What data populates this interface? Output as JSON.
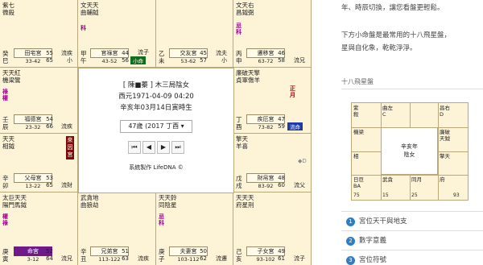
{
  "chart": {
    "cells": [
      {
        "id": "si",
        "stars": "紫七\n微殺",
        "stem": "癸\n巳",
        "palace": "田宅宮",
        "range": "33-42",
        "age": "55\n65",
        "flow": "流疾\n小"
      },
      {
        "id": "wu",
        "stars": "",
        "stem": "甲\n午",
        "palace": "官祿宮",
        "range": "43-52",
        "age": "44\n56",
        "flow": "流子",
        "badge": "小命"
      },
      {
        "id": "wei",
        "stars": "",
        "stem": "乙\n未",
        "palace": "交友宮",
        "range": "53-62",
        "age": "45\n57",
        "flow": "流夫\n小"
      },
      {
        "id": "shen",
        "stars": "文天右\n昌鉞弼",
        "stem": "丙\n申",
        "palace": "遷移宮",
        "range": "63-72",
        "age": "46\n58",
        "flow": "流兄",
        "minor": "忌\n科",
        "mark": "丙"
      },
      {
        "id": "chen",
        "stars": "天天紅\n機梁鸞",
        "stem": "壬\n辰",
        "palace": "福德宮",
        "range": "23-32",
        "age": "54\n66",
        "flow": "流疾",
        "minor": "祿\n權"
      },
      {
        "id": "you",
        "stars": "廉破天擎\n貞軍傷羊",
        "stem": "丁\n酉",
        "palace": "疾厄宮",
        "range": "73-82",
        "age": "47\n59",
        "flow": "流命",
        "minor": "正\n月"
      },
      {
        "id": "mao",
        "stars": "天天\n相鉞",
        "stem": "辛\n卯",
        "palace": "父母宮",
        "range": "13-22",
        "age": "53\n65",
        "flow": "流財",
        "vtag": "來因宮"
      },
      {
        "id": "xu",
        "stars": "擎天\n羊喜",
        "stem": "戊\n戌",
        "palace": "財帛宮",
        "range": "83-92",
        "age": "48\n60",
        "flow": "流父"
      },
      {
        "id": "yin",
        "stars": "太巨天天\n陽門馬鉞",
        "stem": "庚\n寅",
        "palace": "命宮",
        "range": "3-12",
        "age": "52\n64",
        "flow": "流兄",
        "minor": "權\n祿",
        "badge": "命"
      },
      {
        "id": "chou",
        "stars": "武貪地\n曲狼劫",
        "stem": "辛\n丑",
        "palace": "兄弟宮",
        "range": "113-122",
        "age": "51\n63",
        "flow": "流疾"
      },
      {
        "id": "zi",
        "stars": "天天鈴\n同陰星",
        "stem": "庚\n子",
        "palace": "夫妻宮",
        "range": "103-112",
        "age": "50\n62",
        "flow": "流遷",
        "minor": "忌\n科"
      },
      {
        "id": "hai",
        "stars": "天天天\n府星刑",
        "stem": "己\n亥",
        "palace": "子女宮",
        "range": "93-102",
        "age": "49\n61",
        "flow": "流子"
      }
    ],
    "top_mid1_stars": "文天天\n曲輔鉞",
    "top_mid1_mark": "科",
    "center": {
      "line1": "[ 陳■蓁 ] 木三局陰女",
      "line2": "西元1971-04-09 04:20",
      "line3": "辛亥年03月14日寅時生",
      "select": "47歲 (2017 丁酉",
      "nav": [
        "⏮",
        "◀",
        "▶",
        "⏭"
      ],
      "maker": "系統製作 LifeDNA ©"
    }
  },
  "right": {
    "para1": "年、時辰切換，讓您看盤更輕鬆。",
    "para2": "下方小命盤是最常用的十八飛星盤，",
    "para3": "星與自化象，乾乾淨淨。",
    "section": "十八飛星盤",
    "mini": {
      "cells": [
        "紫\n殺",
        "曲左\nC",
        "",
        "昌右\nD",
        "機梁",
        "",
        "",
        "廉破\n天鉞",
        "相",
        "",
        "",
        "擎天",
        "日巨\nBA",
        "武貪",
        "同月\n",
        "府"
      ],
      "center": "辛亥年\n陰女",
      "ages": [
        "75",
        "15",
        "25",
        "62",
        "93",
        "6"
      ]
    },
    "list": [
      {
        "num": "1",
        "label": "宮位天干與地支"
      },
      {
        "num": "2",
        "label": "數字意義"
      },
      {
        "num": "3",
        "label": "宮位符號"
      }
    ]
  }
}
